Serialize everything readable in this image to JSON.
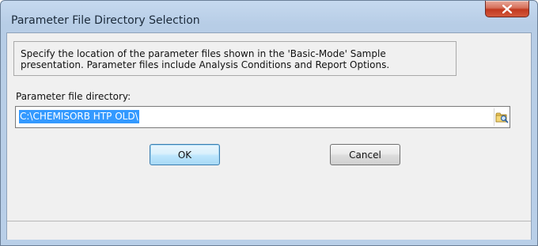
{
  "window": {
    "title": "Parameter File Directory Selection",
    "close_label": "X"
  },
  "description": {
    "line1": "Specify the location of the parameter files shown in the 'Basic-Mode' Sample",
    "line2": "presentation.  Parameter files include Analysis Conditions and Report Options."
  },
  "directory": {
    "label": "Parameter file directory:",
    "value": "C:\\CHEMISORB HTP OLD\\",
    "browse_icon": "folder-browse-icon"
  },
  "buttons": {
    "ok_label": "OK",
    "cancel_label": "Cancel"
  },
  "colors": {
    "selection": "#3399ff",
    "close_button": "#c1391f",
    "titlebar": "#b9cfe8"
  }
}
